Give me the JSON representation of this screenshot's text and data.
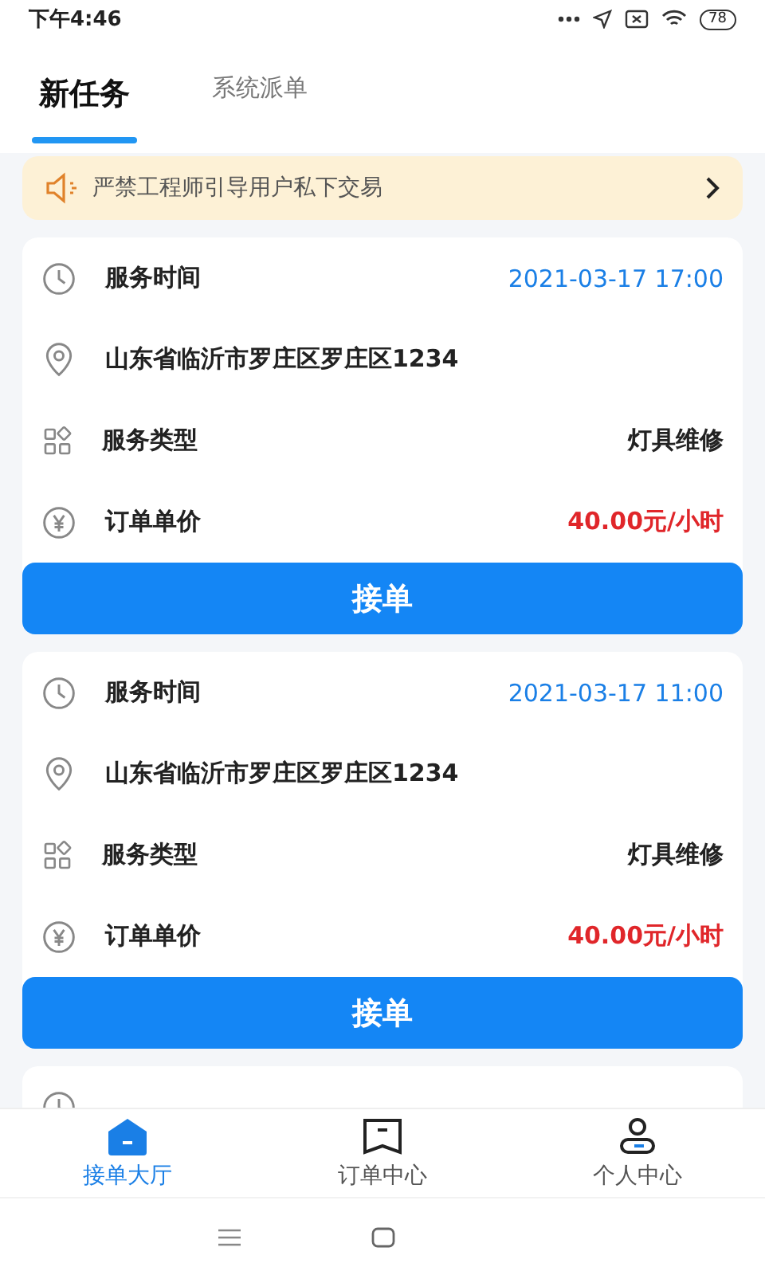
{
  "status_bar": {
    "time": "下午4:46",
    "battery": "78"
  },
  "tabs": [
    {
      "label": "新任务",
      "selected": true
    },
    {
      "label": "系统派单",
      "selected": false
    }
  ],
  "notice": {
    "text": "严禁工程师引导用户私下交易"
  },
  "orders": [
    {
      "fields": [
        {
          "kind": "time",
          "label": "服务时间",
          "value": "2021-03-17 17:00"
        },
        {
          "kind": "address",
          "value": "山东省临沂市罗庄区罗庄区1234"
        },
        {
          "kind": "type",
          "label": "服务类型",
          "value": "灯具维修"
        },
        {
          "kind": "price",
          "label": "订单单价",
          "value": "40.00元/小时"
        }
      ],
      "button": "接单"
    },
    {
      "fields": [
        {
          "kind": "time",
          "label": "服务时间",
          "value": "2021-03-17 11:00"
        },
        {
          "kind": "address",
          "value": "山东省临沂市罗庄区罗庄区1234"
        },
        {
          "kind": "type",
          "label": "服务类型",
          "value": "灯具维修"
        },
        {
          "kind": "price",
          "label": "订单单价",
          "value": "40.00元/小时"
        }
      ],
      "button": "接单"
    },
    {
      "fields": [
        {
          "kind": "time"
        }
      ]
    }
  ],
  "bottom_nav": [
    {
      "kind": "home",
      "label": "接单大厅",
      "selected": true
    },
    {
      "kind": "orders",
      "label": "订单中心",
      "selected": false
    },
    {
      "kind": "profile",
      "label": "个人中心",
      "selected": false
    }
  ]
}
